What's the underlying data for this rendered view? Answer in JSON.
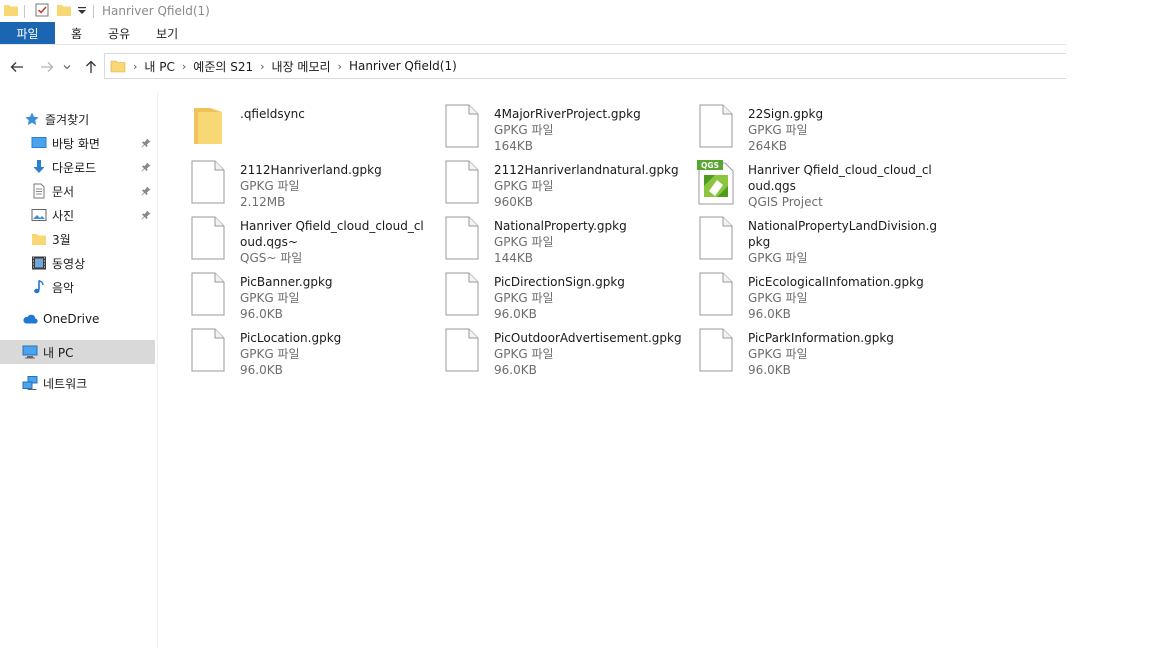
{
  "window": {
    "title": "Hanriver Qfield(1)"
  },
  "ribbon": {
    "tabs": [
      "파일",
      "홈",
      "공유",
      "보기"
    ]
  },
  "breadcrumb": [
    "내 PC",
    "예준의 S21",
    "내장 메모리",
    "Hanriver Qfield(1)"
  ],
  "sidebar": {
    "items": [
      {
        "label": "즐겨찾기",
        "icon": "star-icon"
      },
      {
        "label": "바탕 화면",
        "icon": "desktop-icon",
        "pinned": true
      },
      {
        "label": "다운로드",
        "icon": "download-icon",
        "pinned": true
      },
      {
        "label": "문서",
        "icon": "document-icon",
        "pinned": true
      },
      {
        "label": "사진",
        "icon": "pictures-icon",
        "pinned": true
      },
      {
        "label": "3월",
        "icon": "folder-icon"
      },
      {
        "label": "동영상",
        "icon": "video-icon"
      },
      {
        "label": "음악",
        "icon": "music-icon"
      },
      {
        "label": "OneDrive",
        "icon": "cloud-icon"
      },
      {
        "label": "내 PC",
        "icon": "pc-icon",
        "selected": true
      },
      {
        "label": "네트워크",
        "icon": "network-icon"
      }
    ]
  },
  "files": [
    {
      "name": ".qfieldsync",
      "type": "",
      "size": "",
      "icon": "folder"
    },
    {
      "name": "4MajorRiverProject.gpkg",
      "type": "GPKG 파일",
      "size": "164KB",
      "icon": "file"
    },
    {
      "name": "22Sign.gpkg",
      "type": "GPKG 파일",
      "size": "264KB",
      "icon": "file"
    },
    {
      "name": "2112Hanriverland.gpkg",
      "type": "GPKG 파일",
      "size": "2.12MB",
      "icon": "file"
    },
    {
      "name": "2112Hanriverlandnatural.gpkg",
      "type": "GPKG 파일",
      "size": "960KB",
      "icon": "file"
    },
    {
      "name": "Hanriver Qfield_cloud_cloud_cloud.qgs",
      "type": "QGIS Project",
      "size": "",
      "icon": "qgs"
    },
    {
      "name": "Hanriver Qfield_cloud_cloud_cloud.qgs~",
      "type": "QGS~ 파일",
      "size": "",
      "icon": "file"
    },
    {
      "name": "NationalProperty.gpkg",
      "type": "GPKG 파일",
      "size": "144KB",
      "icon": "file"
    },
    {
      "name": "NationalPropertyLandDivision.gpkg",
      "type": "GPKG 파일",
      "size": "",
      "icon": "file"
    },
    {
      "name": "PicBanner.gpkg",
      "type": "GPKG 파일",
      "size": "96.0KB",
      "icon": "file"
    },
    {
      "name": "PicDirectionSign.gpkg",
      "type": "GPKG 파일",
      "size": "96.0KB",
      "icon": "file"
    },
    {
      "name": "PicEcologicalInfomation.gpkg",
      "type": "GPKG 파일",
      "size": "96.0KB",
      "icon": "file"
    },
    {
      "name": "PicLocation.gpkg",
      "type": "GPKG 파일",
      "size": "96.0KB",
      "icon": "file"
    },
    {
      "name": "PicOutdoorAdvertisement.gpkg",
      "type": "GPKG 파일",
      "size": "96.0KB",
      "icon": "file"
    },
    {
      "name": "PicParkInformation.gpkg",
      "type": "GPKG 파일",
      "size": "96.0KB",
      "icon": "file"
    }
  ],
  "qgs_badge": "QGS",
  "colors": {
    "accent": "#1a66b3",
    "folder": "#f8d775",
    "selected": "#d9d9d9"
  }
}
